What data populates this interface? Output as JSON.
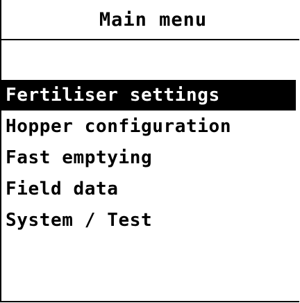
{
  "screen": {
    "title": "Main menu"
  },
  "menu": {
    "selected_index": 0,
    "items": [
      {
        "label": "Fertiliser settings"
      },
      {
        "label": "Hopper configuration"
      },
      {
        "label": "Fast emptying"
      },
      {
        "label": "Field data"
      },
      {
        "label": "System / Test"
      }
    ]
  },
  "colors": {
    "background": "#ffffff",
    "foreground": "#000000",
    "highlight_background": "#000000",
    "highlight_text": "#ffffff"
  }
}
